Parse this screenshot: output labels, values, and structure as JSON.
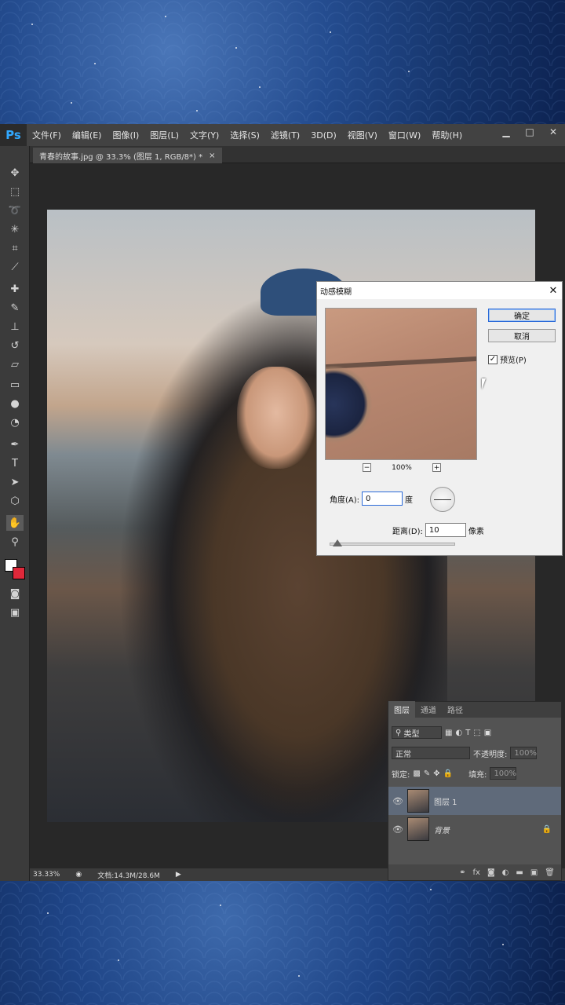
{
  "app": {
    "logo": "Ps"
  },
  "menu": [
    "文件(F)",
    "编辑(E)",
    "图像(I)",
    "图层(L)",
    "文字(Y)",
    "选择(S)",
    "滤镜(T)",
    "3D(D)",
    "视图(V)",
    "窗口(W)",
    "帮助(H)"
  ],
  "window_buttons": [
    "▁",
    "□",
    "✕"
  ],
  "document_tab": {
    "title": "青春的故事.jpg @ 33.3% (图层 1, RGB/8*) *",
    "close": "×"
  },
  "status": {
    "zoom": "33.33%",
    "doc_info": "文档:14.3M/28.6M"
  },
  "dialog": {
    "title": "动感模糊",
    "close": "✕",
    "ok": "确定",
    "cancel": "取消",
    "preview_label": "预览(P)",
    "preview_checked": "✓",
    "zoom_minus": "−",
    "zoom_value": "100%",
    "zoom_plus": "+",
    "angle_label": "角度(A):",
    "angle_value": "0",
    "angle_unit": "度",
    "distance_label": "距离(D):",
    "distance_value": "10",
    "distance_unit": "像素",
    "distance_fraction": 0.02
  },
  "layers_panel": {
    "tabs": [
      "图层",
      "通道",
      "路径"
    ],
    "kind_filter": "类型",
    "blend_mode": "正常",
    "opacity_label": "不透明度:",
    "opacity_value": "100%",
    "lock_label": "锁定:",
    "fill_label": "填充:",
    "fill_value": "100%",
    "layers": [
      {
        "name": "图层 1",
        "active": true
      },
      {
        "name": "背景",
        "active": false
      }
    ]
  },
  "colors": {
    "accent": "#31a8ff",
    "foreground": "#ffffff",
    "background": "#e0283a"
  }
}
